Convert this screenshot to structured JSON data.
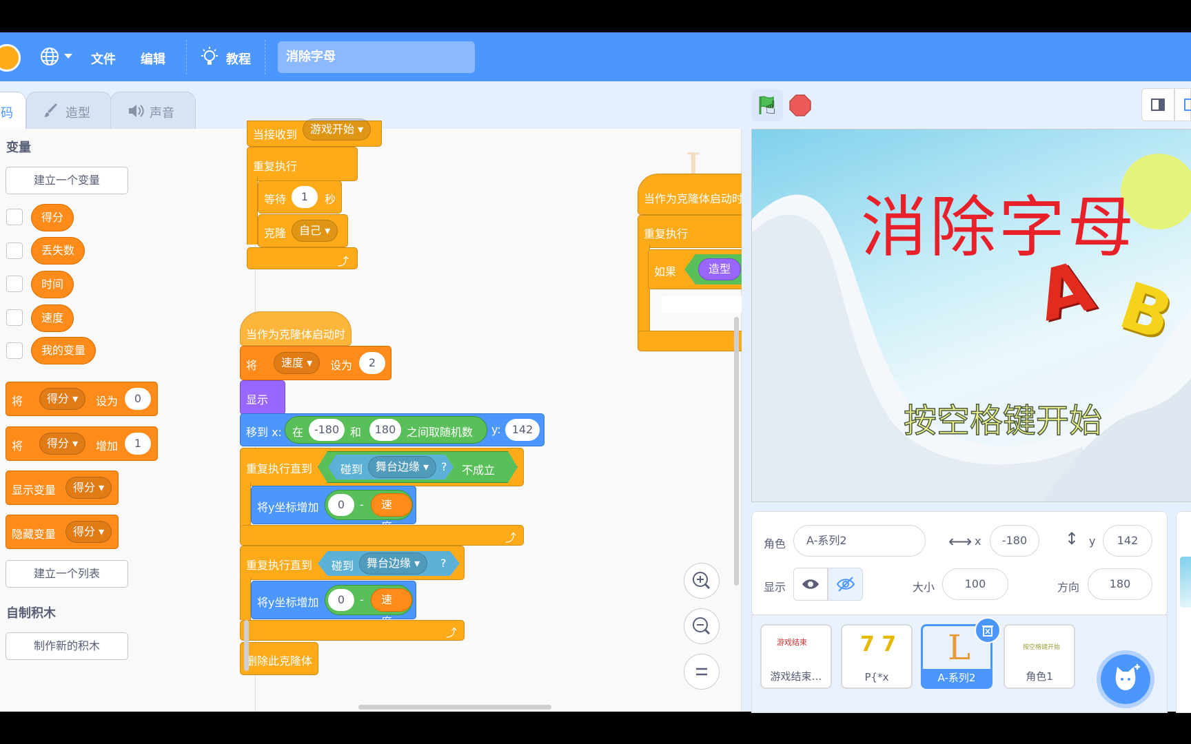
{
  "menu": {
    "file": "文件",
    "edit": "编辑",
    "tutorials": "教程",
    "project_title": "消除字母"
  },
  "tabs": {
    "code_partial": "码",
    "costumes": "造型",
    "sounds": "声音"
  },
  "palette": {
    "variables_title": "变量",
    "make_variable": "建立一个变量",
    "variables": [
      "得分",
      "丢失数",
      "时间",
      "速度",
      "我的变量"
    ],
    "set_block": {
      "verb": "将",
      "var": "得分",
      "op": "设为",
      "value": "0"
    },
    "change_block": {
      "verb": "将",
      "var": "得分",
      "op": "增加",
      "value": "1"
    },
    "show_var_block": {
      "label": "显示变量",
      "var": "得分"
    },
    "hide_var_block": {
      "label": "隐藏变量",
      "var": "得分"
    },
    "make_list": "建立一个列表",
    "my_blocks_title": "自制积木",
    "make_block": "制作新的积木"
  },
  "script1": {
    "hat_partial": "当接收到",
    "hat_msg": "游戏开始",
    "forever": "重复执行",
    "wait": "等待",
    "wait_value": "1",
    "wait_unit": "秒",
    "clone": "克隆",
    "clone_target": "自己"
  },
  "script2": {
    "hat": "当作为克隆体启动时",
    "set_verb": "将",
    "set_var": "速度",
    "set_op": "设为",
    "set_value": "2",
    "show": "显示",
    "goto_label": "移到 x:",
    "random_in": "在",
    "random_from": "-180",
    "random_and": "和",
    "random_to": "180",
    "random_pick": "之间取随机数",
    "goto_y": "y:",
    "goto_y_value": "142",
    "repeat_until1": "重复执行直到",
    "touching": "碰到",
    "edge": "舞台边缘",
    "question": "?",
    "not_label": "不成立",
    "change_y": "将y坐标增加",
    "zero": "0",
    "minus": "-",
    "speed_var": "速度",
    "repeat_until2": "重复执行直到",
    "delete_clone": "删除此克隆体"
  },
  "script3": {
    "hat": "当作为克隆体启动时",
    "forever": "重复执行",
    "if_label": "如果",
    "costume_partial": "造型"
  },
  "stage": {
    "title_text": "消除字母",
    "letters": [
      "A",
      "B"
    ],
    "subtitle_text": "按空格键开始",
    "title_color": "#e8202a"
  },
  "sprite_info": {
    "sprite_label": "角色",
    "sprite_name": "A-系列2",
    "x_label": "x",
    "x_value": "-180",
    "y_label": "y",
    "y_value": "142",
    "show_label": "显示",
    "size_label": "大小",
    "size_value": "100",
    "direction_label": "方向",
    "direction_value": "180"
  },
  "sprites": [
    {
      "name": "游戏结束…",
      "thumb": "游戏结束"
    },
    {
      "name": "P{*x",
      "thumb": "7 7"
    },
    {
      "name": "A-系列2",
      "thumb": "L"
    },
    {
      "name": "角色1",
      "thumb": "按空格键开始"
    }
  ],
  "colors": {
    "menu_blue": "#4c97ff",
    "variables_orange": "#ff8c1a",
    "control_gold": "#ffab19",
    "looks_purple": "#9966ff",
    "motion_blue": "#4c97ff",
    "operators_green": "#59c059",
    "sensing_cyan": "#5cb1d6"
  }
}
